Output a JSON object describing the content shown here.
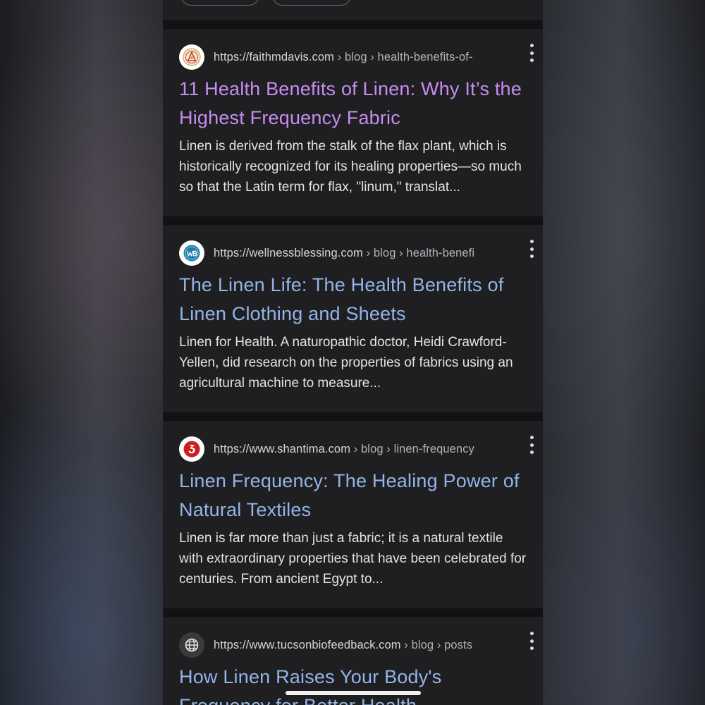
{
  "results": [
    {
      "favicon_icon": "faithmdavis-logo-icon",
      "url_domain": "https://faithmdavis.com",
      "url_path": " › blog › health-benefits-of-",
      "title": "11 Health Benefits of Linen: Why It’s the Highest Frequency Fabric",
      "snippet": "Linen is derived from the stalk of the flax plant, which is historically recognized for its healing properties—so much so that the Latin term for flax, \"linum,\" translat...",
      "visited": true
    },
    {
      "favicon_icon": "wellnessblessing-logo-icon",
      "url_domain": "https://wellnessblessing.com",
      "url_path": " › blog › health-benefi",
      "title": "The Linen Life: The Health Benefits of Linen Clothing and Sheets",
      "snippet": "Linen for Health. A naturopathic doctor, Heidi Crawford-Yellen, did research on the properties of fabrics using an agricultural machine to measure...",
      "visited": false
    },
    {
      "favicon_icon": "shantima-logo-icon",
      "url_domain": "https://www.shantima.com",
      "url_path": " › blog › linen-frequency",
      "title": "Linen Frequency: The Healing Power of Natural Textiles",
      "snippet": "Linen is far more than just a fabric; it is a natural textile with extraordinary properties that have been celebrated for centuries. From ancient Egypt to...",
      "visited": false
    },
    {
      "favicon_icon": "globe-icon",
      "url_domain": "https://www.tucsonbiofeedback.com",
      "url_path": " › blog › posts",
      "title": "How Linen Raises Your Body's Frequency for Better Health",
      "snippet": "",
      "visited": false
    }
  ],
  "colors": {
    "link": "#93b4e8",
    "visited_link": "#c48ef0",
    "card_background": "#1f1f21",
    "page_background": "#121214",
    "snippet_text": "#e3e3e5"
  }
}
